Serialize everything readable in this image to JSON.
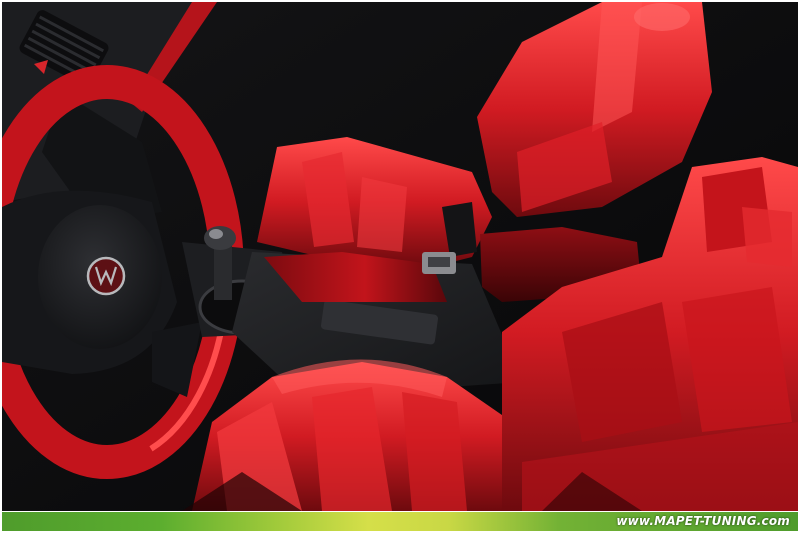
{
  "watermark": {
    "text": "www.MAPET-TUNING.com"
  },
  "photo": {
    "subject": "car-interior",
    "colors": {
      "leather_red": "#c8151e",
      "leather_highlight": "#ff5a5a",
      "shadow": "#0b0b0c",
      "dashboard": "#1b1c1e",
      "trim_grey": "#3a3b3f",
      "caption_green": "#5cae2f"
    }
  }
}
